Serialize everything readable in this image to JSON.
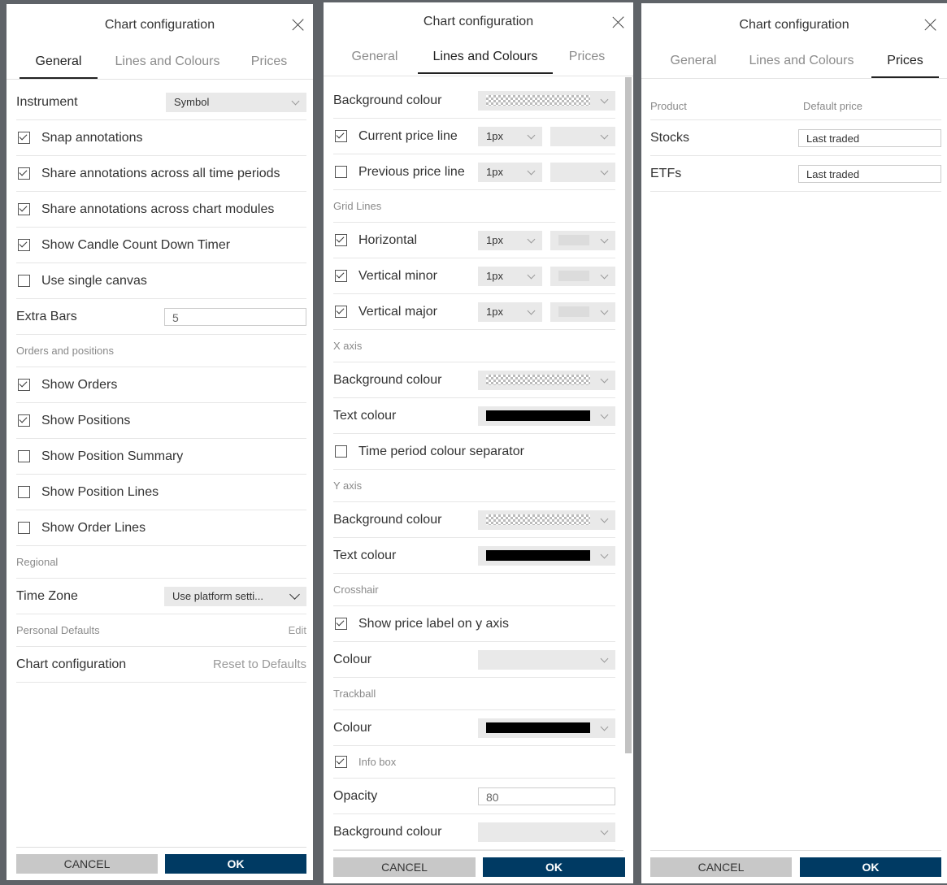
{
  "dialog_title": "Chart configuration",
  "tabs": [
    "General",
    "Lines and Colours",
    "Prices"
  ],
  "footer": {
    "cancel": "CANCEL",
    "ok": "OK"
  },
  "general": {
    "instrument_label": "Instrument",
    "instrument_value": "Symbol",
    "snap_annotations": "Snap annotations",
    "share_time_periods": "Share annotations across all time periods",
    "share_chart_modules": "Share annotations across chart modules",
    "candle_timer": "Show Candle Count Down Timer",
    "single_canvas": "Use single canvas",
    "extra_bars_label": "Extra Bars",
    "extra_bars_value": "5",
    "orders_section": "Orders and positions",
    "show_orders": "Show Orders",
    "show_positions": "Show Positions",
    "show_position_summary": "Show Position Summary",
    "show_position_lines": "Show Position Lines",
    "show_order_lines": "Show Order Lines",
    "regional_section": "Regional",
    "time_zone_label": "Time Zone",
    "time_zone_value": "Use platform setti...",
    "personal_defaults": "Personal Defaults",
    "edit_link": "Edit",
    "chart_config_label": "Chart configuration",
    "reset_link": "Reset to Defaults"
  },
  "lines": {
    "background_colour": "Background colour",
    "current_price_line": "Current price line",
    "previous_price_line": "Previous price line",
    "px": "1px",
    "grid_lines": "Grid Lines",
    "horizontal": "Horizontal",
    "vertical_minor": "Vertical minor",
    "vertical_major": "Vertical major",
    "x_axis": "X axis",
    "text_colour": "Text colour",
    "time_period_sep": "Time period colour separator",
    "y_axis": "Y axis",
    "crosshair": "Crosshair",
    "show_price_label": "Show price label on y axis",
    "colour": "Colour",
    "trackball": "Trackball",
    "info_box": "Info box",
    "opacity": "Opacity",
    "opacity_value": "80"
  },
  "prices": {
    "col_product": "Product",
    "col_default_price": "Default price",
    "rows": [
      {
        "product": "Stocks",
        "price": "Last traded"
      },
      {
        "product": "ETFs",
        "price": "Last traded"
      }
    ]
  }
}
